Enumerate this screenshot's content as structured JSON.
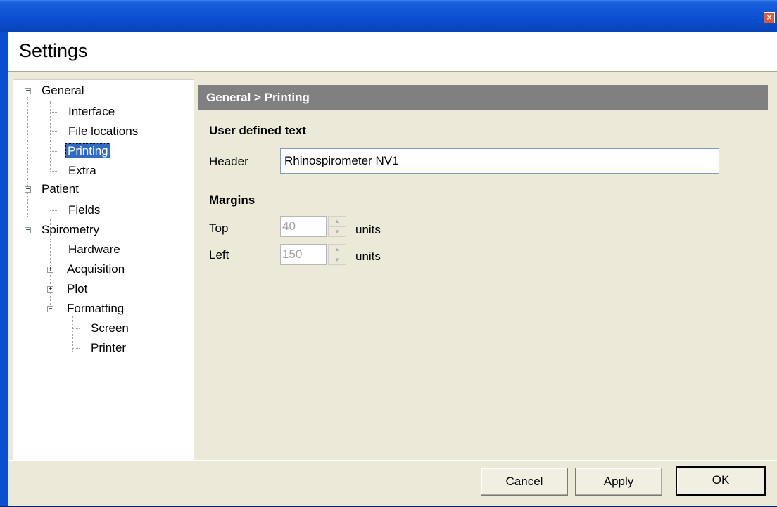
{
  "window": {
    "title": "Settings",
    "close_icon": "close-icon"
  },
  "tree": {
    "items": [
      {
        "label": "General",
        "expander": "−"
      },
      {
        "label": "Interface"
      },
      {
        "label": "File locations"
      },
      {
        "label": "Printing",
        "selected": true
      },
      {
        "label": "Extra"
      },
      {
        "label": "Patient",
        "expander": "−"
      },
      {
        "label": "Fields"
      },
      {
        "label": "Spirometry",
        "expander": "−"
      },
      {
        "label": "Hardware"
      },
      {
        "label": "Acquisition",
        "expander": "+"
      },
      {
        "label": "Plot",
        "expander": "+"
      },
      {
        "label": "Formatting",
        "expander": "−"
      },
      {
        "label": "Screen"
      },
      {
        "label": "Printer"
      }
    ]
  },
  "panel": {
    "breadcrumb": "General > Printing",
    "user_text": {
      "title": "User defined text",
      "header_label": "Header",
      "header_value": "Rhinospirometer NV1"
    },
    "margins": {
      "title": "Margins",
      "top_label": "Top",
      "top_value": "40",
      "left_label": "Left",
      "left_value": "150",
      "unit": "units"
    }
  },
  "footer": {
    "cancel": "Cancel",
    "apply": "Apply",
    "ok": "OK"
  },
  "colors": {
    "titlebar": "#0a4fd0",
    "selection": "#316ac5",
    "panel_header": "#808080",
    "dialog": "#ece9d8"
  }
}
